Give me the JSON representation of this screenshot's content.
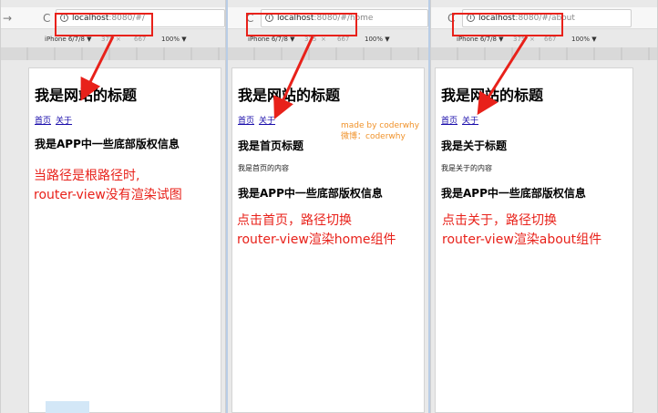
{
  "panels": [
    {
      "id": "root",
      "url_host": "localhost",
      "url_port_path": ":8080/#/",
      "device": "iPhone 6/7/8 ▼",
      "width": "375",
      "x": "×",
      "height": "667",
      "zoom": "100% ▼",
      "site_title": "我是网站的标题",
      "link_home": "首页",
      "link_about": "关于",
      "footer_heading": "我是APP中一些底部版权信息",
      "annotation_line1": "当路径是根路径时,",
      "annotation_line2": "router-view没有渲染试图"
    },
    {
      "id": "home",
      "url_host": "localhost",
      "url_port_path": ":8080/#/home",
      "device": "iPhone 6/7/8 ▼",
      "width": "375",
      "x": "×",
      "height": "667",
      "zoom": "100% ▼",
      "site_title": "我是网站的标题",
      "link_home": "首页",
      "link_about": "关于",
      "view_heading": "我是首页标题",
      "view_content": "我是首页的内容",
      "footer_heading": "我是APP中一些底部版权信息",
      "annotation_line1": "点击首页，路径切换",
      "annotation_line2": "router-view渲染home组件"
    },
    {
      "id": "about",
      "url_host": "localhost",
      "url_port_path": ":8080/#/about",
      "device": "iPhone 6/7/8 ▼",
      "width": "375",
      "x": "×",
      "height": "667",
      "zoom": "100% ▼",
      "site_title": "我是网站的标题",
      "link_home": "首页",
      "link_about": "关于",
      "view_heading": "我是关于标题",
      "view_content": "我是关于的内容",
      "footer_heading": "我是APP中一些底部版权信息",
      "annotation_line1": "点击关于，路径切换",
      "annotation_line2": "router-view渲染about组件"
    }
  ],
  "watermark": {
    "line1": "made by coderwhy",
    "line2": "微博：coderwhy"
  },
  "icons": {
    "back": "←",
    "forward": "→",
    "reload": "C",
    "info": "i"
  },
  "colors": {
    "annotation": "#e8211a",
    "watermark": "#f0922a",
    "link": "#1a0dab"
  }
}
